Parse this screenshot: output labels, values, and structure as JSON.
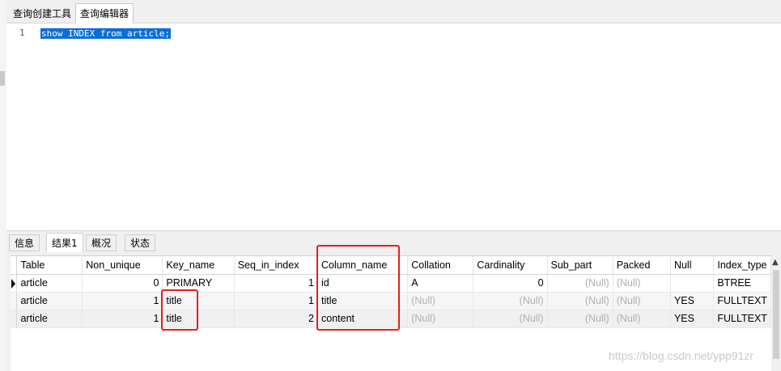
{
  "top_tabs": [
    "查询创建工具",
    "查询编辑器"
  ],
  "editor": {
    "line_number": "1",
    "query": "show INDEX from article;"
  },
  "result_tabs": [
    "信息",
    "结果1",
    "概况",
    "状态"
  ],
  "grid": {
    "columns": [
      "Table",
      "Non_unique",
      "Key_name",
      "Seq_in_index",
      "Column_name",
      "Collation",
      "Cardinality",
      "Sub_part",
      "Packed",
      "Null",
      "Index_type"
    ],
    "rows": [
      [
        "article",
        "0",
        "PRIMARY",
        "1",
        "id",
        "A",
        "0",
        "(Null)",
        "(Null)",
        "",
        "BTREE"
      ],
      [
        "article",
        "1",
        "title",
        "1",
        "title",
        "(Null)",
        "(Null)",
        "(Null)",
        "(Null)",
        "YES",
        "FULLTEXT"
      ],
      [
        "article",
        "1",
        "title",
        "2",
        "content",
        "(Null)",
        "(Null)",
        "(Null)",
        "(Null)",
        "YES",
        "FULLTEXT"
      ]
    ]
  },
  "watermark": "https://blog.csdn.net/ypp91zr",
  "colors": {
    "selection": "#0a6ed9",
    "highlight_box": "#e02020"
  }
}
